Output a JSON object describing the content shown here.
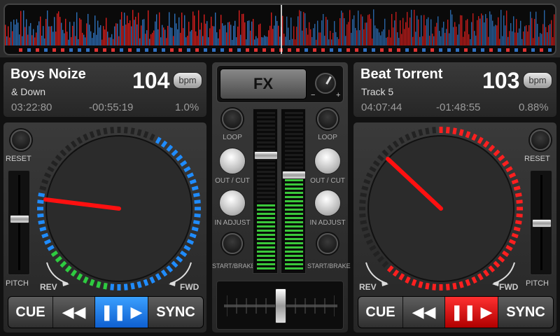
{
  "waveform": {
    "played_color": "#e0201f",
    "unplayed_color": "#2f74c0"
  },
  "deck_left": {
    "artist": "Boys Noize",
    "track": "& Down",
    "bpm": "104",
    "bpm_label": "bpm",
    "elapsed": "03:22:80",
    "remaining": "-00:55:19",
    "pitch_pct": "1.0%",
    "reset_label": "RESET",
    "pitch_label": "PITCH",
    "rev_label": "REV",
    "fwd_label": "FWD",
    "cue_label": "CUE",
    "sync_label": "SYNC",
    "accent": "#1f8cff",
    "pitch_level": 0.45
  },
  "deck_right": {
    "artist": "Beat Torrent",
    "track": "Track 5",
    "bpm": "103",
    "bpm_label": "bpm",
    "elapsed": "04:07:44",
    "remaining": "-01:48:55",
    "pitch_pct": "0.88%",
    "reset_label": "RESET",
    "pitch_label": "PITCH",
    "rev_label": "REV",
    "fwd_label": "FWD",
    "cue_label": "CUE",
    "sync_label": "SYNC",
    "accent": "#ff1f1f",
    "pitch_level": 0.5
  },
  "mixer": {
    "fx_label": "FX",
    "loop_label": "LOOP",
    "outcut_label": "OUT / CUT",
    "inadjust_label": "IN ADJUST",
    "startbrake_label": "START/BRAKE",
    "fx_minus": "−",
    "fx_plus": "+",
    "volume_left": 0.72,
    "volume_right": 0.6,
    "crossfader": 0.5
  }
}
